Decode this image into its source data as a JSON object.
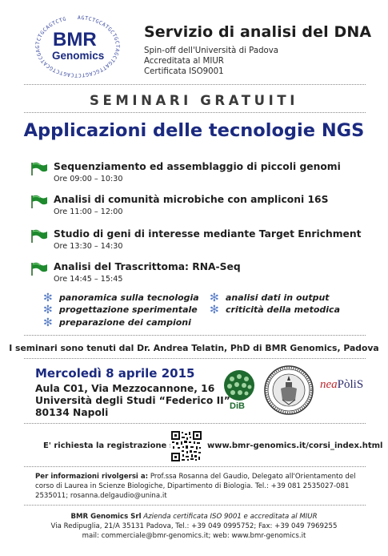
{
  "logo": {
    "line1": "BMR",
    "line2": "Genomics",
    "ring_text": "AGTCTGCATGCTGCTAGCTGATTGCAGTCTCAGTCTGCATCGAGTCTGCAGTCTG"
  },
  "header": {
    "title": "Servizio di analisi del DNA",
    "line1": "Spin-off dell'Università di Padova",
    "line2": "Accreditata al MIUR",
    "line3": "Certificata ISO9001"
  },
  "seminari": "SEMINARI GRATUITI",
  "main_title": "Applicazioni delle tecnologie NGS",
  "topics": [
    {
      "title": "Sequenziamento ed assemblaggio di piccoli genomi",
      "time": "Ore 09:00 – 10:30"
    },
    {
      "title": "Analisi di comunità microbiche con ampliconi 16S",
      "time": "Ore 11:00 – 12:00"
    },
    {
      "title": "Studio di geni di interesse mediante Target Enrichment",
      "time": "Ore 13:30 – 14:30"
    },
    {
      "title": "Analisi del Trascrittoma: RNA-Seq",
      "time": "Ore 14:45 – 15:45"
    }
  ],
  "bullets": [
    "panoramica sulla tecnologia",
    "progettazione sperimentale",
    "preparazione dei campioni",
    "analisi dati in output",
    "criticità della metodica"
  ],
  "speaker_line": "I seminari sono tenuti dal Dr. Andrea Telatin, PhD di  BMR Genomics, Padova",
  "event": {
    "date": "Mercoledì 8 aprile 2015",
    "addr1": "Aula C01, Via Mezzocannone, 16",
    "addr2": "Università degli Studi “Federico II”",
    "addr3": "80134 Napoli"
  },
  "logos": {
    "dib": "DiB",
    "neapolis_a": "nea",
    "neapolis_b": "PòliS"
  },
  "registration": {
    "label": "E' richiesta la registrazione su:",
    "url": "www.bmr-genomics.it/corsi_index.html"
  },
  "info": {
    "lead": "Per informazioni rivolgersi a:",
    "text": " Prof.ssa Rosanna del Gaudio, Delegato all'Orientamento del corso di Laurea in Scienze Biologiche, Dipartimento di Biologia. Tel.: +39 081 2535027-081 2535011; rosanna.delgaudio@unina.it"
  },
  "footer": {
    "company": "BMR Genomics Srl",
    "tagline": "Azienda certificata ISO 9001 e accreditata al MIUR",
    "address": "Via Redipuglia, 21/A  35131 Padova, Tel.: +39 049 0995752; Fax: +39 049 7969255",
    "mail": "mail: commerciale@bmr-genomics.it; web: www.bmr-genomics.it"
  },
  "colors": {
    "accent": "#1b2a80",
    "flag": "#1e8a2e",
    "star": "#5a7fc8",
    "neapolis_red": "#c0282f"
  }
}
